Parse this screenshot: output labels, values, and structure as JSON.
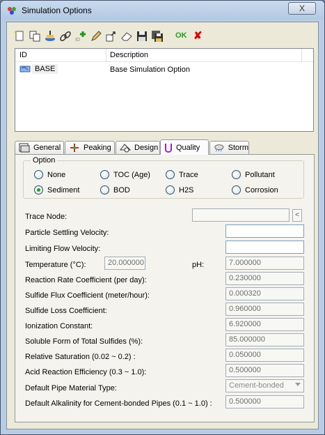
{
  "window": {
    "title": "Simulation Options",
    "close_glyph": "X"
  },
  "toolbar": {
    "icons": [
      "new-icon",
      "copy-icon",
      "import-icon",
      "link-icon",
      "add-icon",
      "edit-icon",
      "open-icon",
      "erase-icon",
      "save-icon",
      "save-all-icon",
      "ok-icon",
      "cancel-icon"
    ],
    "ok_label": "OK",
    "cancel_glyph": "✘"
  },
  "list": {
    "columns": [
      "ID",
      "Description"
    ],
    "rows": [
      {
        "id": "BASE",
        "description": "Base Simulation Option"
      }
    ]
  },
  "tabs": [
    {
      "label": "General",
      "icon": "general-icon"
    },
    {
      "label": "Peaking",
      "icon": "peaking-icon"
    },
    {
      "label": "Design",
      "icon": "design-icon"
    },
    {
      "label": "Quality",
      "icon": "quality-icon",
      "active": true
    },
    {
      "label": "Storm",
      "icon": "storm-icon"
    }
  ],
  "quality": {
    "option_group_label": "Option",
    "options": [
      "None",
      "TOC (Age)",
      "Trace",
      "Pollutant",
      "Sediment",
      "BOD",
      "H2S",
      "Corrosion"
    ],
    "selected": "Sediment",
    "trace_node_label": "Trace Node:",
    "trace_node_value": "",
    "trace_button": "<",
    "particle_velocity_label": "Particle Settling Velocity:",
    "particle_velocity_value": "",
    "limiting_velocity_label": "Limiting Flow Velocity:",
    "limiting_velocity_value": "",
    "temperature_label": "Temperature (°C):",
    "temperature_value": "20.000000",
    "ph_label": "pH:",
    "ph_value": "7.000000",
    "reaction_rate_label": "Reaction Rate Coefficient (per day):",
    "reaction_rate_value": "0.230000",
    "sulfide_flux_label": "Sulfide Flux Coefficient (meter/hour):",
    "sulfide_flux_value": "0.000320",
    "sulfide_loss_label": "Sulfide Loss Coefficient:",
    "sulfide_loss_value": "0.960000",
    "ionization_label": "Ionization Constant:",
    "ionization_value": "6.920000",
    "soluble_form_label": "Soluble Form of Total Sulfides (%):",
    "soluble_form_value": "85.000000",
    "relative_sat_label": "Relative Saturation (0.02 ~ 0.2) :",
    "relative_sat_value": "0.050000",
    "acid_reaction_label": "Acid Reaction Efficiency (0.3 ~ 1.0):",
    "acid_reaction_value": "0.500000",
    "pipe_material_label": "Default Pipe Material Type:",
    "pipe_material_value": "Cement-bonded",
    "alkalinity_label": "Default Alkalinity for Cement-bonded Pipes (0.1 ~ 1.0) :",
    "alkalinity_value": "0.500000"
  }
}
